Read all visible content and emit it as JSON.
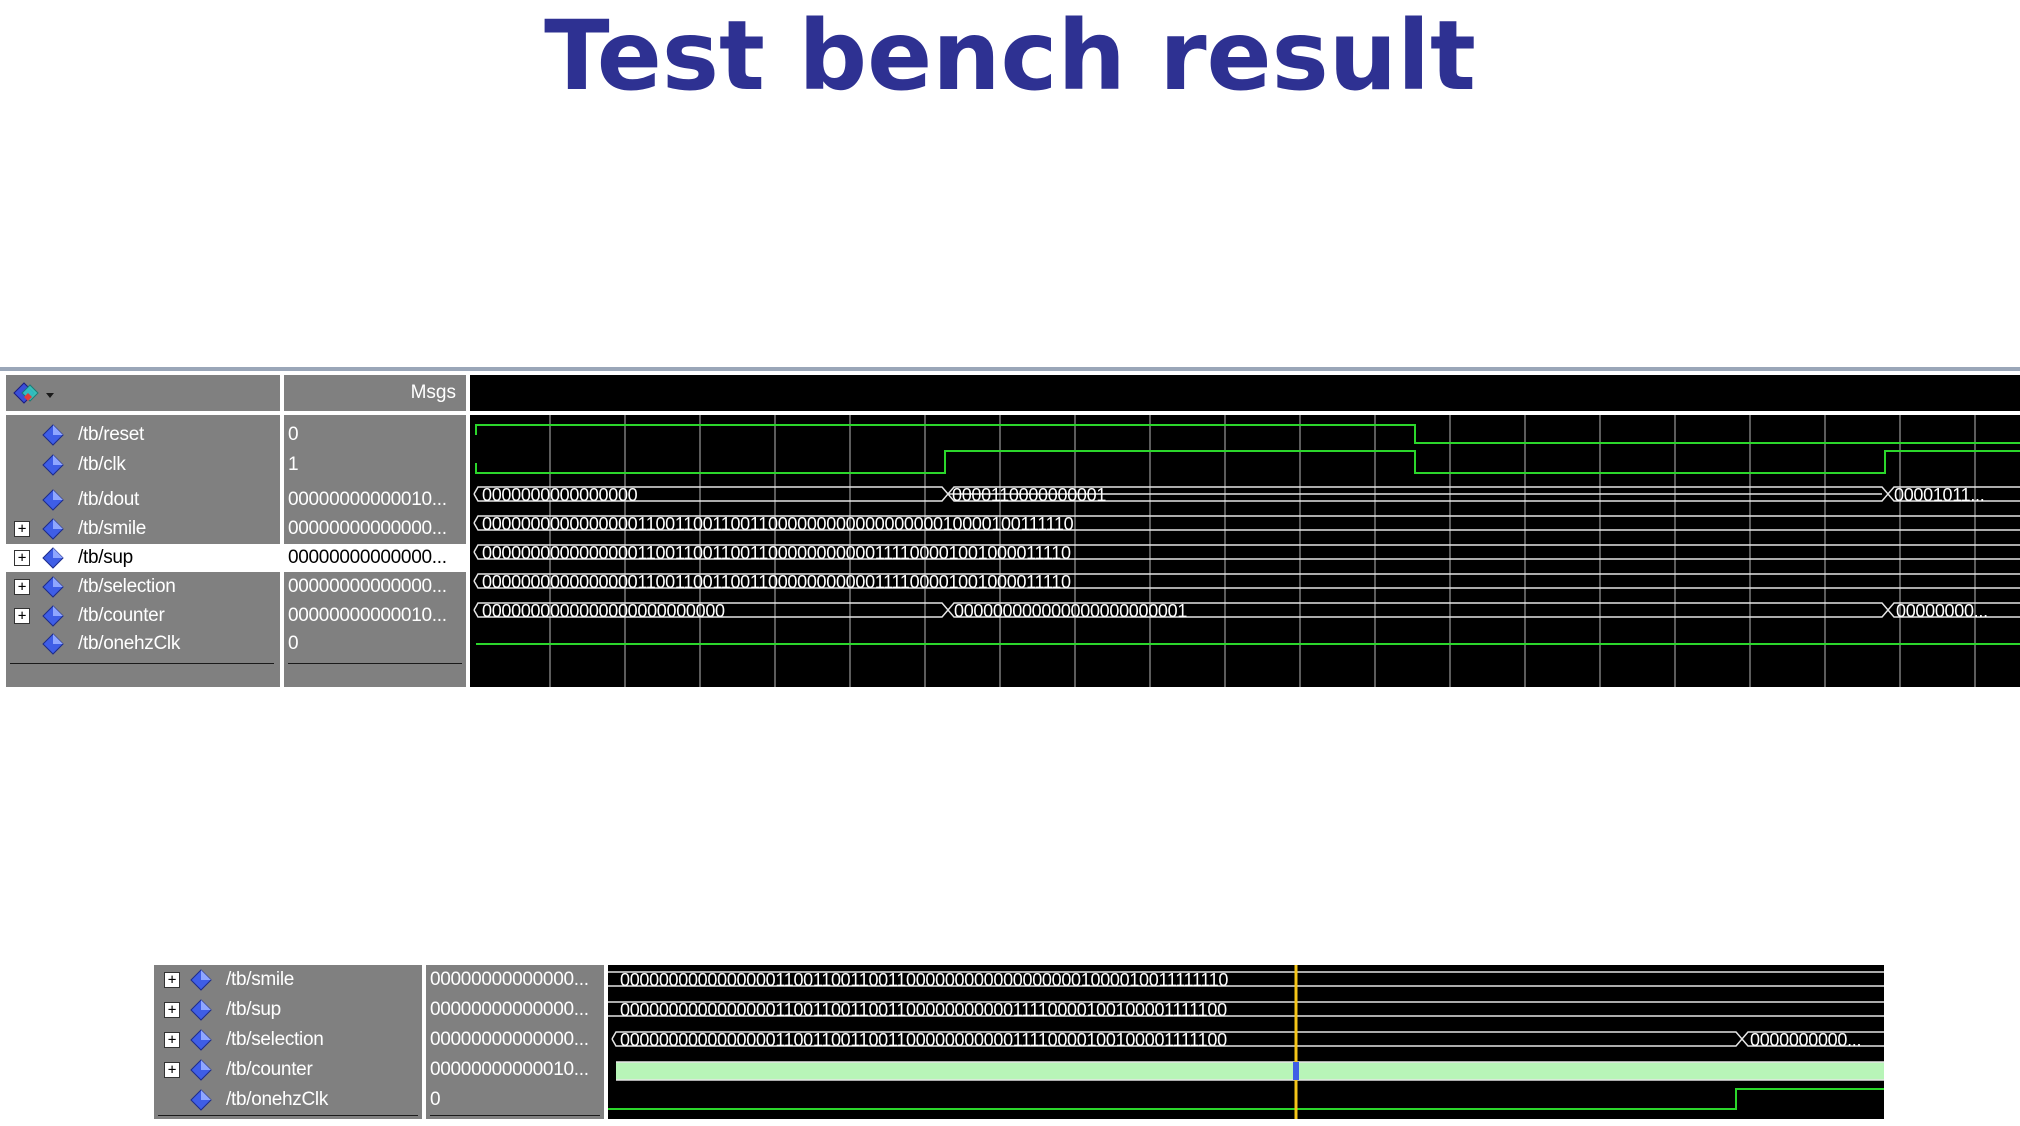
{
  "title": "Test bench result",
  "top": {
    "header": {
      "msgs_label": "Msgs"
    },
    "signals": [
      {
        "name": "/tb/reset",
        "value": "0",
        "expandable": false
      },
      {
        "name": "/tb/clk",
        "value": "1",
        "expandable": false
      },
      {
        "name": "/tb/dout",
        "value": "00000000000010...",
        "expandable": false
      },
      {
        "name": "/tb/smile",
        "value": "00000000000000...",
        "expandable": true
      },
      {
        "name": "/tb/sup",
        "value": "00000000000000...",
        "expandable": true,
        "selected": true
      },
      {
        "name": "/tb/selection",
        "value": "00000000000000...",
        "expandable": true
      },
      {
        "name": "/tb/counter",
        "value": "00000000000010...",
        "expandable": true
      },
      {
        "name": "/tb/onehzClk",
        "value": "0",
        "expandable": false
      }
    ],
    "bus_text": {
      "dout_a": "0000000000000000",
      "dout_b": "0000110000000001",
      "dout_c": "00001011...",
      "smile": "00000000000000001100110011001100000000000000000010000100111110",
      "sup": "00000000000000001100110011001100000000000111100001001000011110",
      "selection": "00000000000000001100110011001100000000000111100001001000011110",
      "counter_a": "0000000000000000000000000",
      "counter_b": "000000000000000000000001",
      "counter_c": "00000000..."
    }
  },
  "bottom": {
    "signals": [
      {
        "name": "/tb/smile",
        "value": "00000000000000...",
        "expandable": true
      },
      {
        "name": "/tb/sup",
        "value": "00000000000000...",
        "expandable": true
      },
      {
        "name": "/tb/selection",
        "value": "00000000000000...",
        "expandable": true
      },
      {
        "name": "/tb/counter",
        "value": "00000000000010...",
        "expandable": true
      },
      {
        "name": "/tb/onehzClk",
        "value": "0",
        "expandable": false
      }
    ],
    "bus_text": {
      "smile": "0000000000000000110011001100110000000000000000001000010011111110",
      "sup": "0000000000000000110011001100110000000000011110000100100001111100",
      "selection": "0000000000000000110011001100110000000000011110000100100001111100",
      "selection_b": "0000000000..."
    }
  },
  "colors": {
    "title": "#2e3192",
    "wave_green": "#2bd62b",
    "bus_white": "#e6e6e6",
    "cursor_yellow": "#f5c518",
    "grid": "#8c8c8c",
    "counter_fill": "#b8f5b8"
  }
}
